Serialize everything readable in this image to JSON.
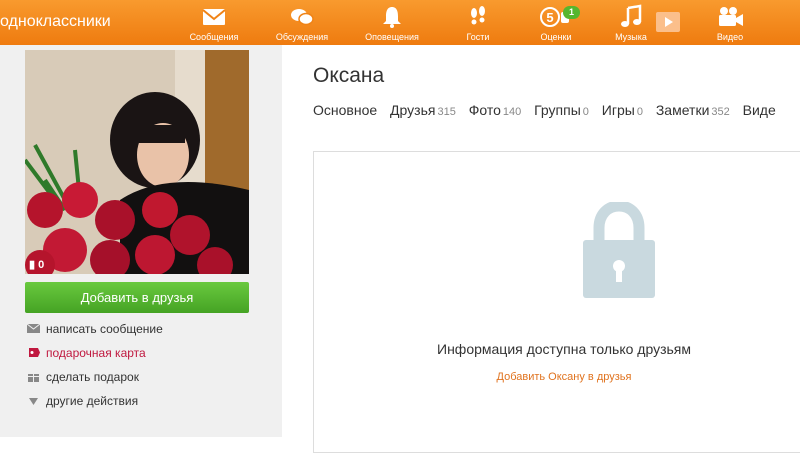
{
  "logo": {
    "text": "одноклассники"
  },
  "nav": [
    {
      "label": "Сообщения",
      "icon": "envelope-icon"
    },
    {
      "label": "Обсуждения",
      "icon": "chat-bubbles-icon"
    },
    {
      "label": "Оповещения",
      "icon": "bell-icon"
    },
    {
      "label": "Гости",
      "icon": "footprints-icon"
    },
    {
      "label": "Оценки",
      "icon": "rating-five-icon",
      "badge": "1"
    },
    {
      "label": "Музыка",
      "icon": "music-note-icon"
    },
    {
      "label": "Видео",
      "icon": "video-camera-icon"
    }
  ],
  "profile": {
    "name": "Оксана",
    "photo_comments": "0",
    "add_friend_button": "Добавить в друзья",
    "actions": [
      {
        "label": "написать сообщение",
        "icon": "envelope-icon"
      },
      {
        "label": "подарочная карта",
        "icon": "gift-card-icon"
      },
      {
        "label": "сделать подарок",
        "icon": "gift-icon"
      },
      {
        "label": "другие действия",
        "icon": "triangle-down-icon"
      }
    ],
    "tabs": [
      {
        "label": "Основное",
        "count": ""
      },
      {
        "label": "Друзья",
        "count": "315"
      },
      {
        "label": "Фото",
        "count": "140"
      },
      {
        "label": "Группы",
        "count": "0"
      },
      {
        "label": "Игры",
        "count": "0"
      },
      {
        "label": "Заметки",
        "count": "352"
      },
      {
        "label": "Виде",
        "count": ""
      }
    ]
  },
  "restricted": {
    "message": "Информация доступна только друзьям",
    "link": "Добавить Оксану в друзья"
  },
  "colors": {
    "orange": "#f08316",
    "green": "#4caf2a",
    "lock": "#c9d9df",
    "link": "#e0731f"
  }
}
